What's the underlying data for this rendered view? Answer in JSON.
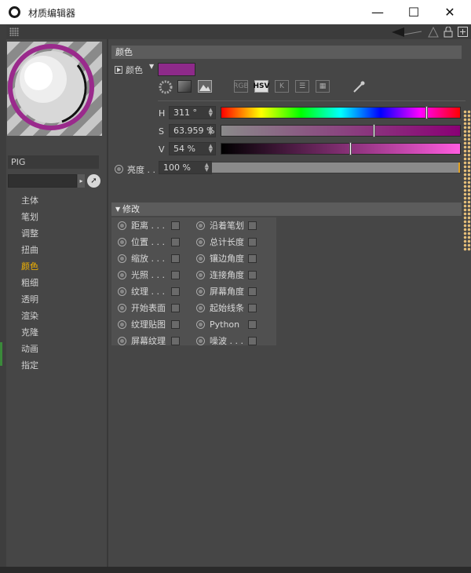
{
  "window": {
    "title": "材质编辑器",
    "minimize_glyph": "—",
    "maximize_glyph": "☐",
    "close_glyph": "✕"
  },
  "toolbar": {
    "icons": [
      "back-arrow-icon",
      "forward-arrow-icon",
      "up-arrow-icon",
      "lock-icon",
      "new-panel-icon"
    ]
  },
  "material": {
    "name": "PIG"
  },
  "channels": [
    {
      "label": "主体",
      "active": false
    },
    {
      "label": "笔划",
      "active": false
    },
    {
      "label": "调整",
      "active": false
    },
    {
      "label": "扭曲",
      "active": false
    },
    {
      "label": "颜色",
      "active": true
    },
    {
      "label": "粗细",
      "active": false
    },
    {
      "label": "透明",
      "active": false
    },
    {
      "label": "渲染",
      "active": false
    },
    {
      "label": "克隆",
      "active": false
    },
    {
      "label": "动画",
      "active": false
    },
    {
      "label": "指定",
      "active": false
    }
  ],
  "color_section": {
    "header": "颜色",
    "color_label": "颜色",
    "color_hex": "#8e2a8a",
    "modes": [
      "RGB",
      "HSV",
      "K"
    ],
    "active_mode": "HSV",
    "h": {
      "label": "H",
      "value": "311 °",
      "fraction": 0.864
    },
    "s": {
      "label": "S",
      "value": "63.959 %",
      "fraction": 0.64
    },
    "v": {
      "label": "V",
      "value": "54 %",
      "fraction": 0.54
    },
    "brightness": {
      "label": "亮度 . .",
      "value": "100 %",
      "fraction": 1.0
    }
  },
  "modifiers": {
    "header": "修改",
    "left_column": [
      "距离 . . .",
      "位置 . . .",
      "缩放 . . .",
      "光照 . . .",
      "纹理 . . .",
      "开始表面",
      "纹理贴图",
      "屏幕纹理"
    ],
    "right_column": [
      "沿着笔划",
      "总计长度",
      "镶边角度",
      "连接角度",
      "屏幕角度",
      "起始线条",
      "Python",
      "噪波 . . ."
    ]
  },
  "colors": {
    "panel_bg": "#464646",
    "accent_active": "#f4b400"
  }
}
